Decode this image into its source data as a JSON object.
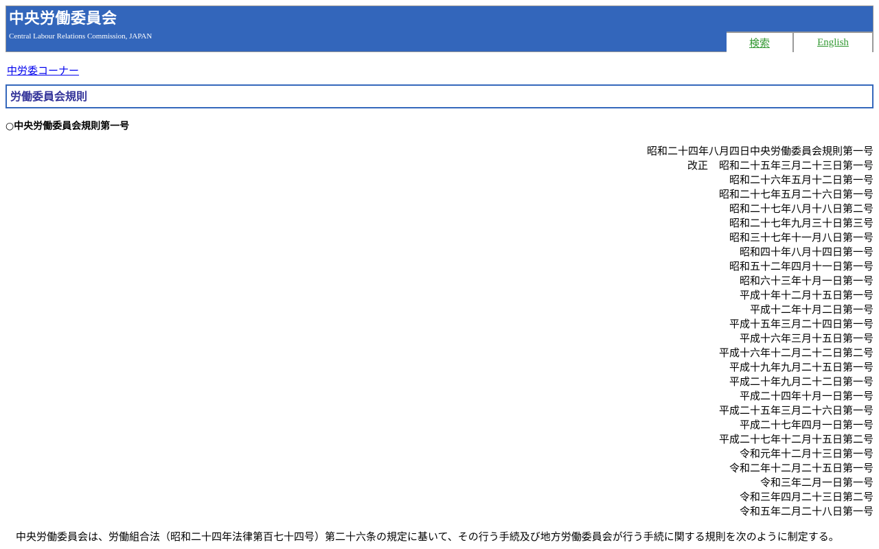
{
  "colors": {
    "header_bg": "#3366bb",
    "heading_text": "#333399",
    "header_link": "#339933",
    "link": "#0000ee"
  },
  "header": {
    "title": "中央労働委員会",
    "subtitle": "Central Labour Relations Commission, JAPAN",
    "search_label": "検索",
    "english_label": "English"
  },
  "breadcrumb": {
    "link_label": "中労委コーナー"
  },
  "page": {
    "heading": "労働委員会規則"
  },
  "rule": {
    "title": "○中央労働委員会規則第一号",
    "enactment": "昭和二十四年八月四日中央労働委員会規則第一号",
    "amend_label": "改正",
    "amendments": [
      "昭和二十五年三月二十三日第一号",
      "昭和二十六年五月十二日第一号",
      "昭和二十七年五月二十六日第一号",
      "昭和二十七年八月十八日第二号",
      "昭和二十七年九月三十日第三号",
      "昭和三十七年十一月八日第一号",
      "昭和四十年八月十四日第一号",
      "昭和五十二年四月十一日第一号",
      "昭和六十三年十月一日第一号",
      "平成十年十二月十五日第一号",
      "平成十二年十月二日第一号",
      "平成十五年三月二十四日第一号",
      "平成十六年三月十五日第一号",
      "平成十六年十二月二十二日第二号",
      "平成十九年九月二十五日第一号",
      "平成二十年九月二十二日第一号",
      "平成二十四年十月一日第一号",
      "平成二十五年三月二十六日第一号",
      "平成二十七年四月一日第一号",
      "平成二十七年十二月十五日第二号",
      "令和元年十二月十三日第一号",
      "令和二年十二月二十五日第一号",
      "令和三年二月一日第一号",
      "令和三年四月二十三日第二号",
      "令和五年二月二十八日第一号"
    ],
    "preamble": "中央労働委員会は、労働組合法（昭和二十四年法律第百七十四号）第二十六条の規定に基いて、その行う手続及び地方労働委員会が行う手続に関する規則を次のように制定する。"
  }
}
